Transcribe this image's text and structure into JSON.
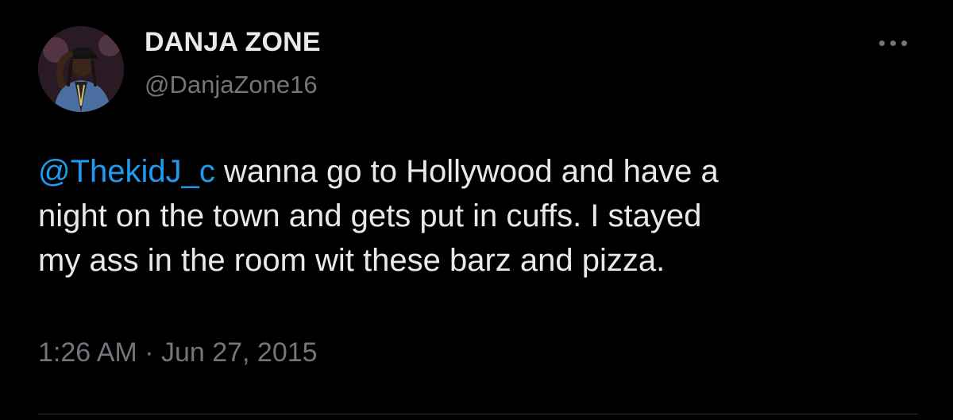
{
  "colors": {
    "background": "#000000",
    "text": "#e7e9ea",
    "secondary": "#71767b",
    "link": "#1d9bf0",
    "divider": "#2f3336"
  },
  "author": {
    "display_name": "DANJA ZONE",
    "handle": "@DanjaZone16",
    "avatar_icon": "user-avatar"
  },
  "more_icon": "more-horizontal-icon",
  "tweet": {
    "mention": "@ThekidJ_c",
    "line1_rest": " wanna go to Hollywood and have a",
    "line2": "night on the town and gets put in cuffs. I stayed",
    "line3": "my ass in the room wit these barz and pizza.",
    "timestamp": "1:26 AM · Jun 27, 2015"
  }
}
